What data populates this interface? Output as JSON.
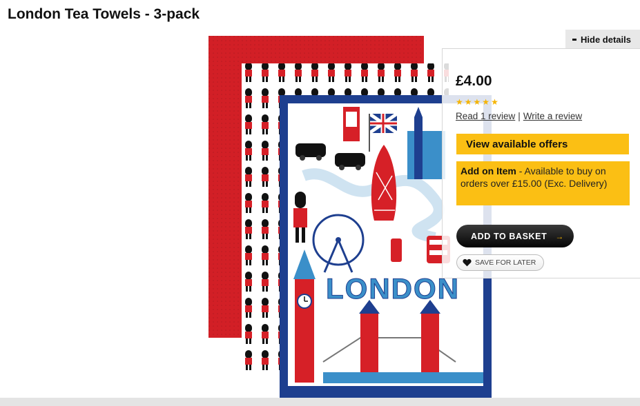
{
  "product": {
    "title": "London Tea Towels - 3-pack",
    "image_text": "LONDON",
    "price": "£4.00",
    "rating_stars": 5
  },
  "toggle": {
    "label": "Hide details"
  },
  "reviews": {
    "read_label": "Read 1 review",
    "separator": "|",
    "write_label": "Write a review"
  },
  "offers": {
    "label": "View available offers"
  },
  "addon": {
    "title": "Add on Item",
    "text": " - Available to buy on orders over £15.00 (Exc. Delivery)"
  },
  "actions": {
    "basket_label": "ADD TO BASKET",
    "save_label": "SAVE FOR LATER"
  },
  "colors": {
    "accent_yellow": "#fbbf14",
    "star": "#f5b400",
    "towel_red": "#d62027",
    "towel_blue": "#1e3f8f"
  },
  "icons": {
    "toggle": "minus-icon",
    "basket_arrow": "arrow-right-icon",
    "save": "heart-icon",
    "star": "star-icon"
  }
}
